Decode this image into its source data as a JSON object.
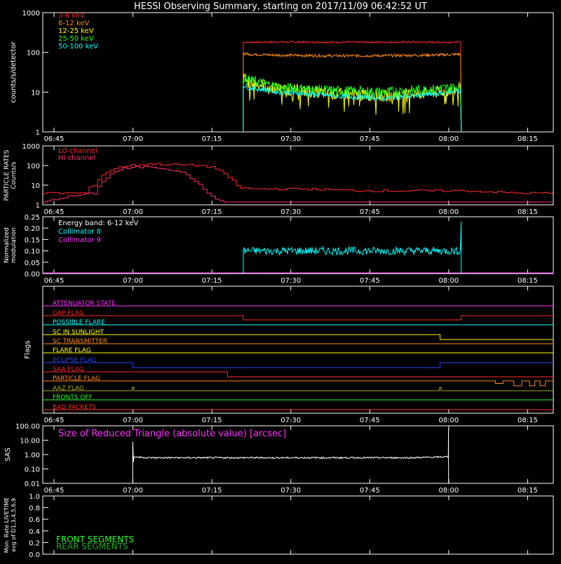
{
  "title": "HESSI Observing Summary, starting on 2017/11/09 06:42:52 UT",
  "colors": {
    "background": "#000000",
    "axes": "#ffffff",
    "red": "#ff2a2a",
    "orange": "#ff8c1a",
    "yellow": "#ffff00",
    "green": "#22ff22",
    "cyan": "#00ffff",
    "magenta": "#ff33ff",
    "crimson": "#ff2d6e",
    "dkgreen": "#22aa22",
    "blue": "#2244ff",
    "olive": "#aaaa22"
  },
  "time_ticks": [
    "06:45",
    "07:00",
    "07:15",
    "07:30",
    "07:45",
    "08:00",
    "08:15"
  ],
  "chart_data": [
    {
      "type": "line",
      "panel": "count-rates",
      "ylabel": "counts/s/detector",
      "ylog": true,
      "ylim": [
        1,
        1000
      ],
      "yticks": [
        "1",
        "10",
        "100",
        "1000"
      ],
      "x_unit": "minutes after 06:42:52",
      "observation_window": [
        "07:21",
        "08:02"
      ],
      "series": [
        {
          "name": "3-6 keV",
          "color": "#ff2a2a",
          "x": [
            38.1,
            39,
            45,
            55,
            65,
            75,
            79.5
          ],
          "values": [
            180,
            180,
            182,
            180,
            181,
            180,
            180
          ]
        },
        {
          "name": "6-12 keV",
          "color": "#ff8c1a",
          "x": [
            38.1,
            39,
            45,
            55,
            65,
            75,
            79.5
          ],
          "values": [
            95,
            90,
            85,
            82,
            83,
            86,
            90
          ]
        },
        {
          "name": "12-25 keV",
          "color": "#ffff00",
          "x": [
            38.1,
            39,
            45,
            55,
            65,
            75,
            79.5
          ],
          "values": [
            22,
            18,
            12,
            9,
            8,
            10,
            12
          ]
        },
        {
          "name": "25-50 keV",
          "color": "#22ff22",
          "x": [
            38.1,
            39,
            45,
            55,
            65,
            75,
            79.5
          ],
          "values": [
            24,
            20,
            13,
            11,
            10,
            12,
            14
          ]
        },
        {
          "name": "50-100 keV",
          "color": "#00ffff",
          "x": [
            38.1,
            39,
            45,
            55,
            65,
            75,
            79.5
          ],
          "values": [
            15,
            13,
            10,
            8,
            7,
            9,
            11
          ]
        }
      ]
    },
    {
      "type": "line",
      "panel": "particle-rates",
      "ylabel": "PARTICLE RATES Counts/s",
      "ylog": true,
      "ylim": [
        1,
        1000
      ],
      "yticks": [
        "1",
        "10",
        "100",
        "1000"
      ],
      "series": [
        {
          "name": "LO channel",
          "color": "#ff2a2a",
          "x": [
            0,
            8,
            10,
            12,
            15,
            20,
            25,
            30,
            33,
            35,
            37,
            40,
            50,
            60,
            70,
            80,
            90,
            97
          ],
          "values": [
            3,
            3,
            10,
            40,
            80,
            110,
            100,
            90,
            60,
            20,
            6,
            5,
            5,
            4,
            4,
            4,
            3,
            3
          ]
        },
        {
          "name": "HI channel",
          "color": "#ff2d6e",
          "x": [
            0,
            10,
            12,
            15,
            20,
            25,
            28,
            30,
            32,
            34,
            97
          ],
          "values": [
            1,
            3,
            20,
            60,
            80,
            50,
            20,
            5,
            2,
            1,
            1
          ]
        }
      ]
    },
    {
      "type": "line",
      "panel": "modulation",
      "ylabel": "Normalized modulation",
      "annotation": "Energy band: 6-12 keV",
      "ylim": [
        0,
        0.25
      ],
      "yticks": [
        "0.00",
        "0.05",
        "0.10",
        "0.15",
        "0.20",
        "0.25"
      ],
      "series": [
        {
          "name": "Collimator 8",
          "color": "#00ffff",
          "x": [
            38.1,
            79.5
          ],
          "values": [
            0.1,
            0.1
          ]
        },
        {
          "name": "Collimator 9",
          "color": "#ff33ff",
          "x": [
            0,
            97
          ],
          "values": [
            0.0,
            0.0
          ]
        }
      ]
    },
    {
      "type": "line",
      "panel": "flags",
      "ylabel": "Flags",
      "flags": [
        {
          "name": "ATTENUATOR STATE",
          "color": "#ff33ff"
        },
        {
          "name": "GAP FLAG",
          "color": "#ff2a2a"
        },
        {
          "name": "POSSIBLE FLARE",
          "color": "#00ffff"
        },
        {
          "name": "SC IN SUNLIGHT",
          "color": "#ffff00"
        },
        {
          "name": "SC TRANSMITTER",
          "color": "#ff8c1a"
        },
        {
          "name": "FLARE FLAG",
          "color": "#ffff00"
        },
        {
          "name": "ECLIPSE FLAG",
          "color": "#2244ff"
        },
        {
          "name": "SAA FLAG",
          "color": "#ff2a2a"
        },
        {
          "name": "PARTICLE FLAG",
          "color": "#ff8c1a"
        },
        {
          "name": "AAZ FLAG",
          "color": "#aaaa22"
        },
        {
          "name": "FRONTS OFF",
          "color": "#22ff22"
        },
        {
          "name": "BAD PACKETS",
          "color": "#ff2a2a"
        }
      ]
    },
    {
      "type": "line",
      "panel": "sas",
      "ylabel": "SAS",
      "annotation": "Size of Reduced Triangle (absolute value) [arcsec]",
      "ylog": true,
      "ylim": [
        0.01,
        100
      ],
      "yticks": [
        "0.01",
        "0.10",
        "1.00",
        "10.00",
        "100.00"
      ],
      "series": [
        {
          "name": "Size of Reduced Triangle",
          "color": "#ffffff",
          "x": [
            17.1,
            20,
            30,
            40,
            50,
            60,
            70,
            77.1
          ],
          "values": [
            0.7,
            0.6,
            0.6,
            0.6,
            0.6,
            0.6,
            0.6,
            0.7
          ]
        }
      ]
    },
    {
      "type": "line",
      "panel": "livetime",
      "ylabel": "Mon. Rate LIVETIME avg of D1,3,4,5,6,9",
      "ylim": [
        0.0,
        1.0
      ],
      "yticks": [
        "0.0",
        "0.2",
        "0.4",
        "0.6",
        "0.8",
        "1.0"
      ],
      "legend": [
        "FRONT SEGMENTS",
        "REAR SEGMENTS"
      ]
    }
  ]
}
